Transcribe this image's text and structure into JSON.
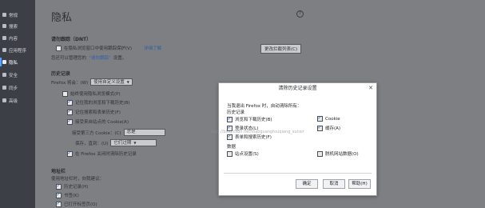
{
  "sidebar": {
    "items": [
      {
        "label": "常规",
        "icon": "home-icon"
      },
      {
        "label": "搜索",
        "icon": "search-icon"
      },
      {
        "label": "内容",
        "icon": "content-icon"
      },
      {
        "label": "应用程序",
        "icon": "apps-icon"
      },
      {
        "label": "隐私",
        "icon": "privacy-mask-icon",
        "active": true
      },
      {
        "label": "安全",
        "icon": "lock-icon"
      },
      {
        "label": "同步",
        "icon": "sync-icon"
      },
      {
        "label": "高级",
        "icon": "gear-icon"
      }
    ]
  },
  "page": {
    "title": "隐私",
    "help": "?"
  },
  "dnt": {
    "title": "请勿跟踪（DNT）",
    "option": "在隐私浏览窗口中使用跟踪保护(V)",
    "learn_more": "详细了解",
    "change_list": "更改拦截列表(C)",
    "desc_prefix": "您还可以管理您的",
    "desc_link": "“请勿跟踪”",
    "desc_suffix": "设置。"
  },
  "history": {
    "title": "历史记录",
    "firefox_label": "Firefox 将会：(W)",
    "firefox_value": "使用自定义设置",
    "always_private": "始终使用隐私浏览模式(P)",
    "remember_browse": "记住我的浏览和下载历史(B)",
    "remember_search": "记住搜索和表单历史(F)",
    "accept_cookies": "接受来自站点的 Cookie(A)",
    "third_party_label": "接受第三方 Cookie：(C)",
    "third_party_value": "总是",
    "keep_label": "保存，直到：(U)",
    "keep_value": "它们过期",
    "clear_on_close": "在 Firefox 关闭时清除历史记录"
  },
  "address_bar": {
    "title": "地址栏",
    "desc": "使用地址栏时，向我建议：",
    "history": "历史记录(H)",
    "bookmarks": "书签(K)",
    "open_tabs": "已打开标签页(O)"
  },
  "dialog": {
    "title": "清除历史记录设置",
    "close": "✕",
    "intro": "当我退出 Firefox 时，自动清除所有：",
    "history_label": "历史记录",
    "items": [
      {
        "label": "浏览和下载历史(B)",
        "checked": true
      },
      {
        "label": "Cookie",
        "checked": true
      },
      {
        "label": "登录状态(L)",
        "checked": true
      },
      {
        "label": "缓存(A)",
        "checked": true
      },
      {
        "label": "表单和搜索历史(F)",
        "checked": true
      }
    ],
    "data_label": "数据",
    "data_items": [
      {
        "label": "站点设置(S)",
        "checked": false
      },
      {
        "label": "脱机网站数据(O)",
        "checked": false
      }
    ],
    "ok": "确定",
    "cancel": "取消",
    "help": "帮助(H)"
  },
  "watermark": "http://blog.csdn.net/xiaoguangtouqiang_sunsir"
}
